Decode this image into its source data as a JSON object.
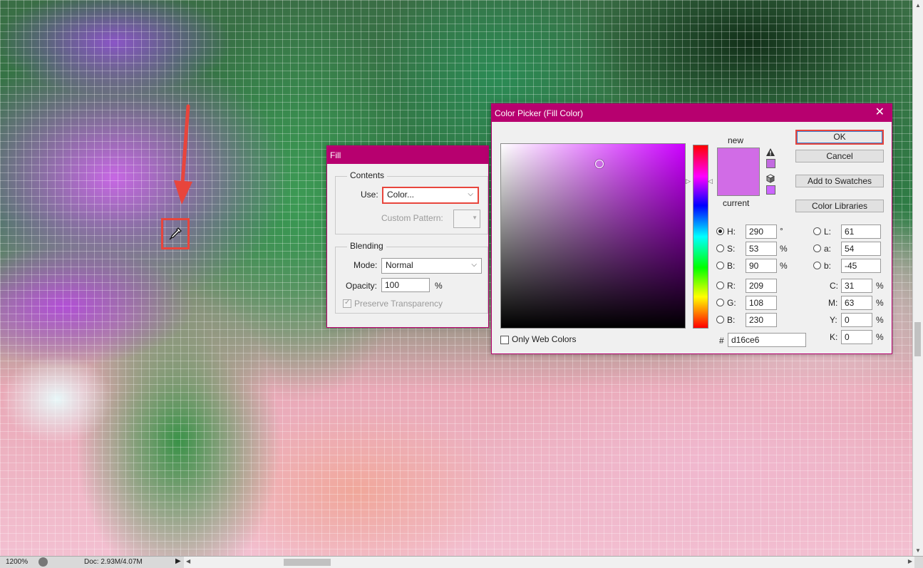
{
  "status": {
    "zoom": "1200%",
    "doc": "Doc: 2.93M/4.07M"
  },
  "fill_dialog": {
    "title": "Fill",
    "contents_title": "Contents",
    "use_label": "Use:",
    "use_value": "Color...",
    "custom_pattern_label": "Custom Pattern:",
    "blending_title": "Blending",
    "mode_label": "Mode:",
    "mode_value": "Normal",
    "opacity_label": "Opacity:",
    "opacity_value": "100",
    "opacity_unit": "%",
    "preserve_label": "Preserve Transparency"
  },
  "picker": {
    "title": "Color Picker (Fill Color)",
    "new_label": "new",
    "current_label": "current",
    "ok": "OK",
    "cancel": "Cancel",
    "add_swatches": "Add to Swatches",
    "libraries": "Color Libraries",
    "only_web": "Only Web Colors",
    "hex_label": "#",
    "hex": "d16ce6",
    "colors": {
      "new": "#d16ce6",
      "current": "#d16ce6"
    },
    "hsb": [
      {
        "label": "H:",
        "value": "290",
        "unit": "°"
      },
      {
        "label": "S:",
        "value": "53",
        "unit": "%"
      },
      {
        "label": "B:",
        "value": "90",
        "unit": "%"
      }
    ],
    "rgb": [
      {
        "label": "R:",
        "value": "209"
      },
      {
        "label": "G:",
        "value": "108"
      },
      {
        "label": "B:",
        "value": "230"
      }
    ],
    "lab": [
      {
        "label": "L:",
        "value": "61"
      },
      {
        "label": "a:",
        "value": "54"
      },
      {
        "label": "b:",
        "value": "-45"
      }
    ],
    "cmyk": [
      {
        "label": "C:",
        "value": "31",
        "unit": "%"
      },
      {
        "label": "M:",
        "value": "63",
        "unit": "%"
      },
      {
        "label": "Y:",
        "value": "0",
        "unit": "%"
      },
      {
        "label": "K:",
        "value": "0",
        "unit": "%"
      }
    ],
    "icons": {
      "close": "close-icon",
      "gamut_warning": "warning-icon",
      "web_safe": "cube-icon"
    }
  }
}
